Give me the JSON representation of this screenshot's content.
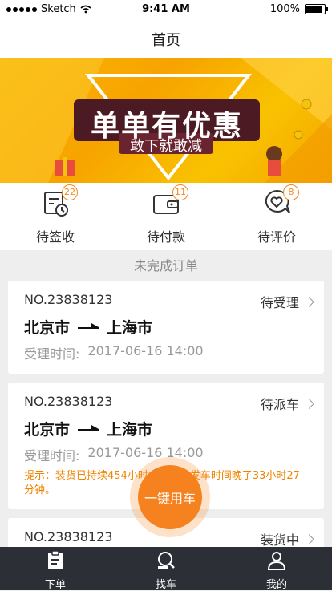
{
  "status_bar": {
    "carrier": "Sketch",
    "time": "9:41 AM",
    "battery": "100%"
  },
  "nav": {
    "title": "首页"
  },
  "banner": {
    "headline": "单单有优惠",
    "sub": "敢下就敢减"
  },
  "quick_actions": [
    {
      "label": "待签收",
      "badge": "22",
      "icon": "calendar-clock-icon"
    },
    {
      "label": "待付款",
      "badge": "11",
      "icon": "wallet-icon"
    },
    {
      "label": "待评价",
      "badge": "8",
      "icon": "heart-chat-icon"
    }
  ],
  "section_title": "未完成订单",
  "orders": [
    {
      "no": "NO.23838123",
      "status": "待受理",
      "from": "北京市",
      "to": "上海市",
      "time_label": "受理时间:",
      "time": "2017-06-16 14:00",
      "tip": ""
    },
    {
      "no": "NO.23838123",
      "status": "待派车",
      "from": "北京市",
      "to": "上海市",
      "time_label": "受理时间:",
      "time": "2017-06-16 14:00",
      "tip": "提示：装货已持续454小时，比预计发车时间晚了33小时27分钟。"
    },
    {
      "no": "NO.23838123",
      "status": "装货中"
    }
  ],
  "fab": {
    "label": "一键用车"
  },
  "tabs": [
    {
      "label": "下单",
      "icon": "clipboard-icon"
    },
    {
      "label": "找车",
      "icon": "search-truck-icon"
    },
    {
      "label": "我的",
      "icon": "person-icon"
    }
  ],
  "colors": {
    "accent": "#f5821f",
    "tabbar": "#2c2f36"
  }
}
